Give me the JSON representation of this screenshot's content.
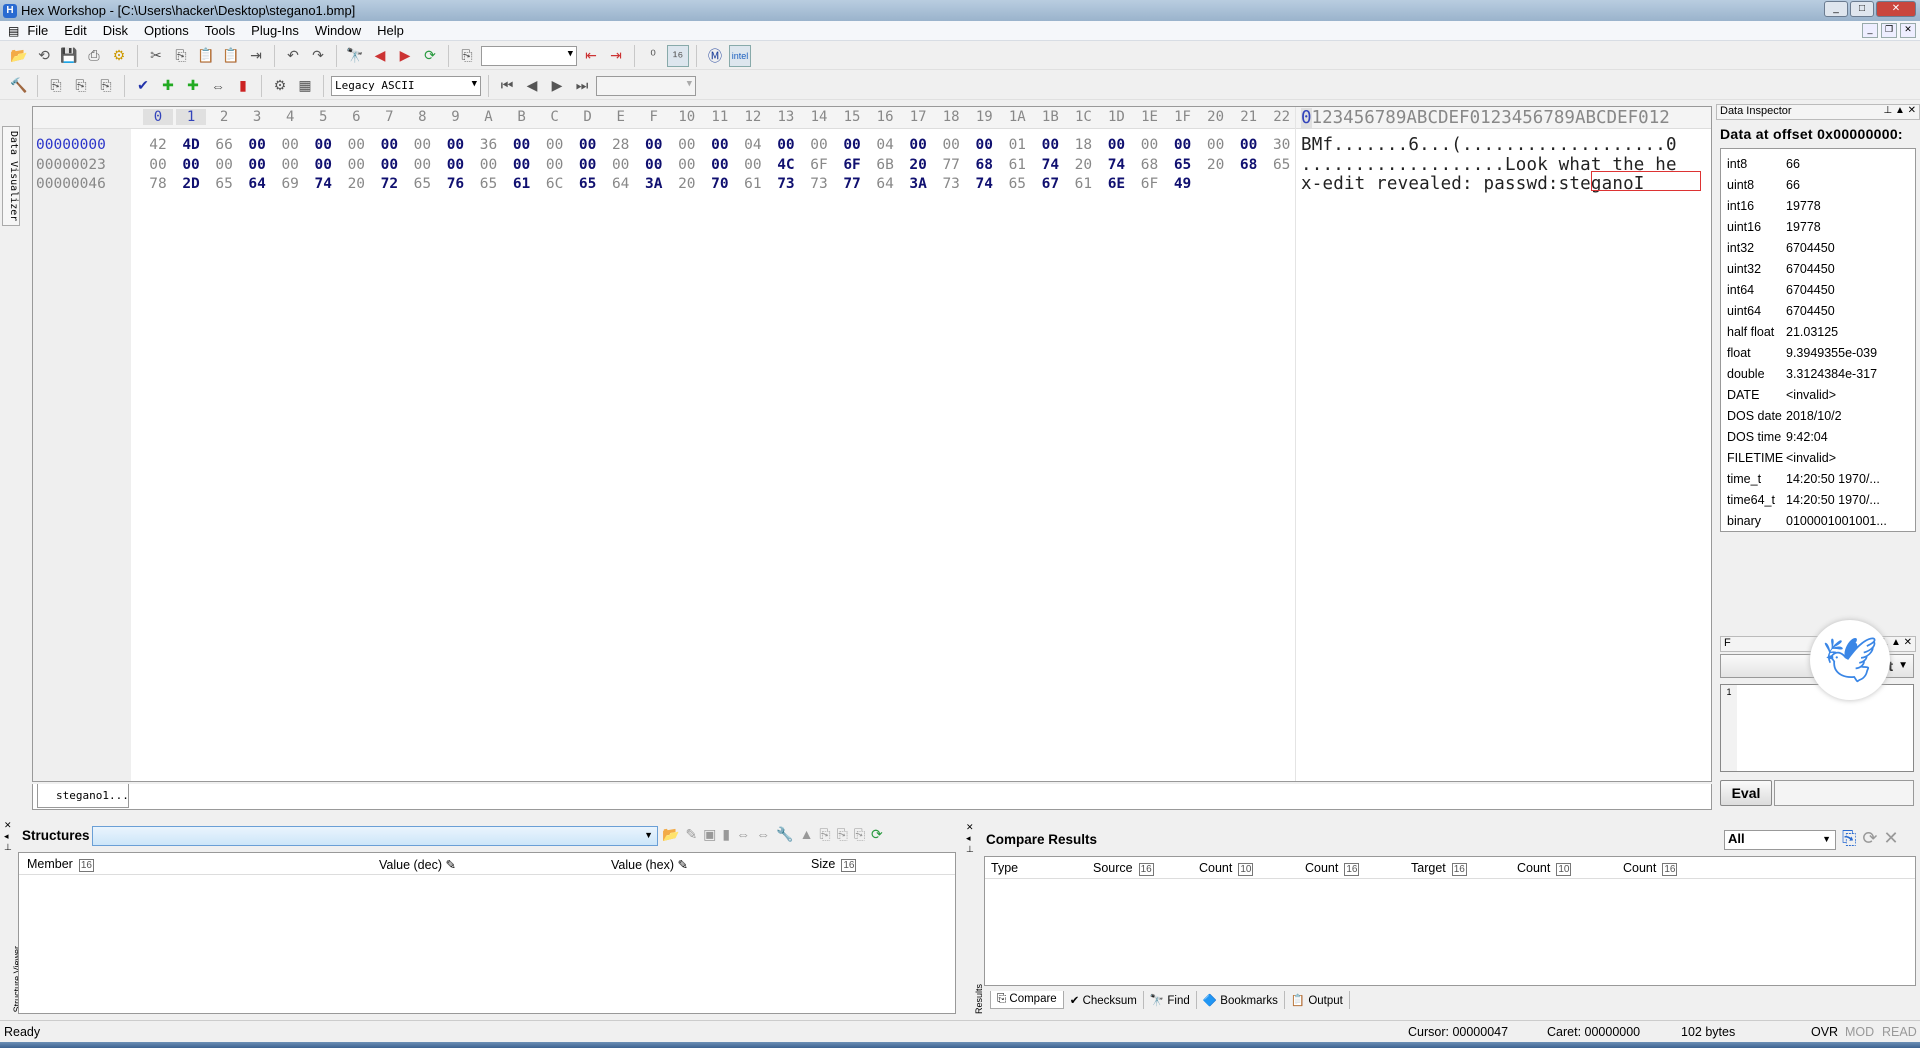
{
  "window": {
    "title": "Hex Workshop - [C:\\Users\\hacker\\Desktop\\stegano1.bmp]"
  },
  "menu": [
    "File",
    "Edit",
    "Disk",
    "Options",
    "Tools",
    "Plug-Ins",
    "Window",
    "Help"
  ],
  "toolbar": {
    "encoding": "Legacy ASCII",
    "search_value": "",
    "nav_value": ""
  },
  "left_strip": {
    "label": "Data Visualizer"
  },
  "hex": {
    "columns": [
      "0",
      "1",
      "2",
      "3",
      "4",
      "5",
      "6",
      "7",
      "8",
      "9",
      "A",
      "B",
      "C",
      "D",
      "E",
      "F",
      "10",
      "11",
      "12",
      "13",
      "14",
      "15",
      "16",
      "17",
      "18",
      "19",
      "1A",
      "1B",
      "1C",
      "1D",
      "1E",
      "1F",
      "20",
      "21",
      "22"
    ],
    "ascii_header": "0123456789ABCDEF0123456789ABCDEF012",
    "rows": [
      {
        "offset": "00000000",
        "bytes": [
          "42",
          "4D",
          "66",
          "00",
          "00",
          "00",
          "00",
          "00",
          "00",
          "00",
          "36",
          "00",
          "00",
          "00",
          "28",
          "00",
          "00",
          "00",
          "04",
          "00",
          "00",
          "00",
          "04",
          "00",
          "00",
          "00",
          "01",
          "00",
          "18",
          "00",
          "00",
          "00",
          "00",
          "00",
          "30"
        ],
        "ascii": "BMf.......6...(...................0"
      },
      {
        "offset": "00000023",
        "bytes": [
          "00",
          "00",
          "00",
          "00",
          "00",
          "00",
          "00",
          "00",
          "00",
          "00",
          "00",
          "00",
          "00",
          "00",
          "00",
          "00",
          "00",
          "00",
          "00",
          "4C",
          "6F",
          "6F",
          "6B",
          "20",
          "77",
          "68",
          "61",
          "74",
          "20",
          "74",
          "68",
          "65",
          "20",
          "68",
          "65"
        ],
        "ascii": "...................Look what the he"
      },
      {
        "offset": "00000046",
        "bytes": [
          "78",
          "2D",
          "65",
          "64",
          "69",
          "74",
          "20",
          "72",
          "65",
          "76",
          "65",
          "61",
          "6C",
          "65",
          "64",
          "3A",
          "20",
          "70",
          "61",
          "73",
          "73",
          "77",
          "64",
          "3A",
          "73",
          "74",
          "65",
          "67",
          "61",
          "6E",
          "6F",
          "49"
        ],
        "ascii": "x-edit revealed: passwd:steganoI"
      }
    ]
  },
  "doc_tab": "stegano1...",
  "inspector": {
    "panel_title": "Data Inspector",
    "heading": "Data at offset 0x00000000:",
    "rows": [
      {
        "k": "int8",
        "v": "66"
      },
      {
        "k": "uint8",
        "v": "66"
      },
      {
        "k": "int16",
        "v": "19778"
      },
      {
        "k": "uint16",
        "v": "19778"
      },
      {
        "k": "int32",
        "v": "6704450"
      },
      {
        "k": "uint32",
        "v": "6704450"
      },
      {
        "k": "int64",
        "v": "6704450"
      },
      {
        "k": "uint64",
        "v": "6704450"
      },
      {
        "k": "half float",
        "v": "21.03125"
      },
      {
        "k": "float",
        "v": "9.3949355e-039"
      },
      {
        "k": "double",
        "v": "3.3124384e-317"
      },
      {
        "k": "DATE",
        "v": "<invalid>"
      },
      {
        "k": "DOS date",
        "v": "2018/10/2"
      },
      {
        "k": "DOS time",
        "v": "9:42:04"
      },
      {
        "k": "FILETIME",
        "v": "<invalid>"
      },
      {
        "k": "time_t",
        "v": "14:20:50 1970/..."
      },
      {
        "k": "time64_t",
        "v": "14:20:50 1970/..."
      },
      {
        "k": "binary",
        "v": "0100001001001..."
      }
    ]
  },
  "func_panel": {
    "title": "F",
    "combo": "it",
    "line": "1",
    "eval": "Eval"
  },
  "structures": {
    "title": "Structures",
    "side_label": "Structure Viewer",
    "columns": [
      "Member",
      "Value (dec)",
      "Value (hex)",
      "Size"
    ]
  },
  "compare": {
    "title": "Compare Results",
    "filter": "All",
    "side_label": "Results",
    "columns": [
      "Type",
      "Source",
      "Count",
      "Count",
      "Target",
      "Count",
      "Count"
    ],
    "tabs": [
      "Compare",
      "Checksum",
      "Find",
      "Bookmarks",
      "Output"
    ]
  },
  "status": {
    "ready": "Ready",
    "cursor": "Cursor: 00000047",
    "caret": "Caret: 00000000",
    "size": "102 bytes",
    "ovr": "OVR",
    "mod": "MOD",
    "read": "READ"
  }
}
